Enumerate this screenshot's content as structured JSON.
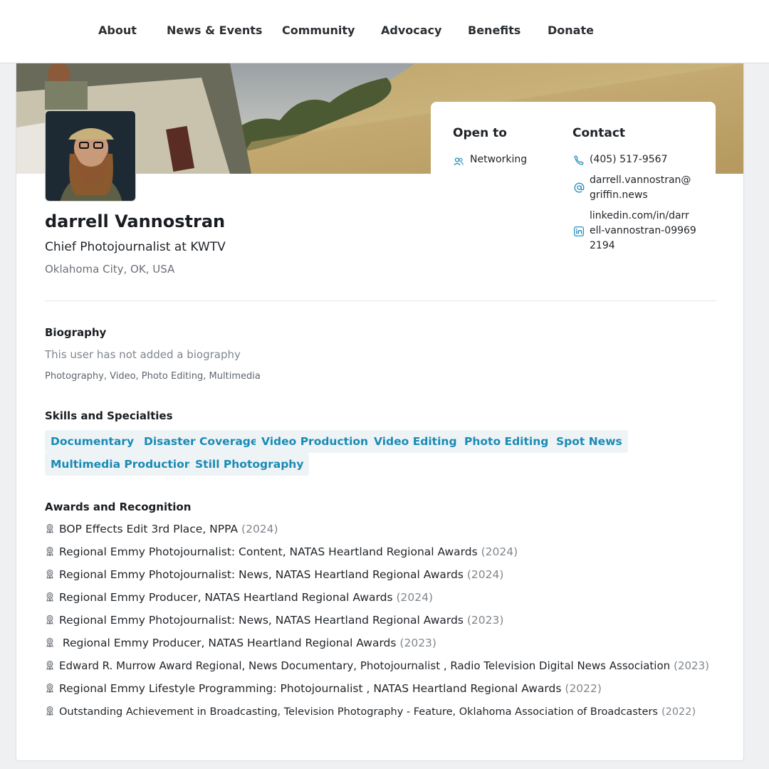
{
  "nav": {
    "items": [
      {
        "label": "About"
      },
      {
        "label": "News & Events"
      },
      {
        "label": "Community"
      },
      {
        "label": "Advocacy"
      },
      {
        "label": "Benefits"
      },
      {
        "label": "Donate"
      }
    ]
  },
  "profile": {
    "name": "darrell Vannostran",
    "title": "Chief Photojournalist at KWTV",
    "location": "Oklahoma City, OK, USA"
  },
  "open_to": {
    "heading": "Open to",
    "items": [
      {
        "label": "Networking",
        "icon": "people-icon"
      }
    ]
  },
  "contact": {
    "heading": "Contact",
    "phone": "(405) 517-9567",
    "email_line1": "darrell.vannostran@",
    "email_line2": "griffin.news",
    "linkedin_line1": "linkedin.com/in/darr",
    "linkedin_line2": "ell-vannostran-09969",
    "linkedin_line3": "2194"
  },
  "biography": {
    "heading": "Biography",
    "text": "This user has not added a biography",
    "interests": "Photography, Video, Photo Editing, Multimedia"
  },
  "skills": {
    "heading": "Skills and Specialties",
    "items": [
      "Documentary",
      "Disaster Coverage",
      "Video Production",
      "Video Editing",
      "Photo Editing",
      "Spot News",
      "Multimedia Production",
      "Still Photography"
    ]
  },
  "awards": {
    "heading": "Awards and Recognition",
    "items": [
      {
        "text": "BOP Effects Edit 3rd Place, NPPA",
        "year": "(2024)"
      },
      {
        "text": "Regional Emmy Photojournalist: Content, NATAS Heartland Regional Awards",
        "year": "(2024)"
      },
      {
        "text": "Regional Emmy Photojournalist: News, NATAS Heartland Regional Awards",
        "year": "(2024)"
      },
      {
        "text": "Regional Emmy Producer, NATAS Heartland Regional Awards",
        "year": "(2024)"
      },
      {
        "text": "Regional Emmy Photojournalist: News, NATAS Heartland Regional Awards",
        "year": "(2023)"
      },
      {
        "text": " Regional Emmy Producer, NATAS Heartland Regional Awards",
        "year": "(2023)"
      },
      {
        "text": "Edward R. Murrow Award Regional, News Documentary, Photojournalist , Radio Television Digital News Association",
        "year": "(2023)"
      },
      {
        "text": "Regional Emmy Lifestyle Programming: Photojournalist , NATAS Heartland Regional Awards",
        "year": "(2022)"
      },
      {
        "text": "Outstanding Achievement in Broadcasting, Television Photography - Feature, Oklahoma Association of Broadcasters",
        "year": "(2022)"
      }
    ]
  },
  "colors": {
    "accent": "#1a8ab5",
    "tag_bg": "#eef4f6",
    "muted": "#80868c"
  }
}
